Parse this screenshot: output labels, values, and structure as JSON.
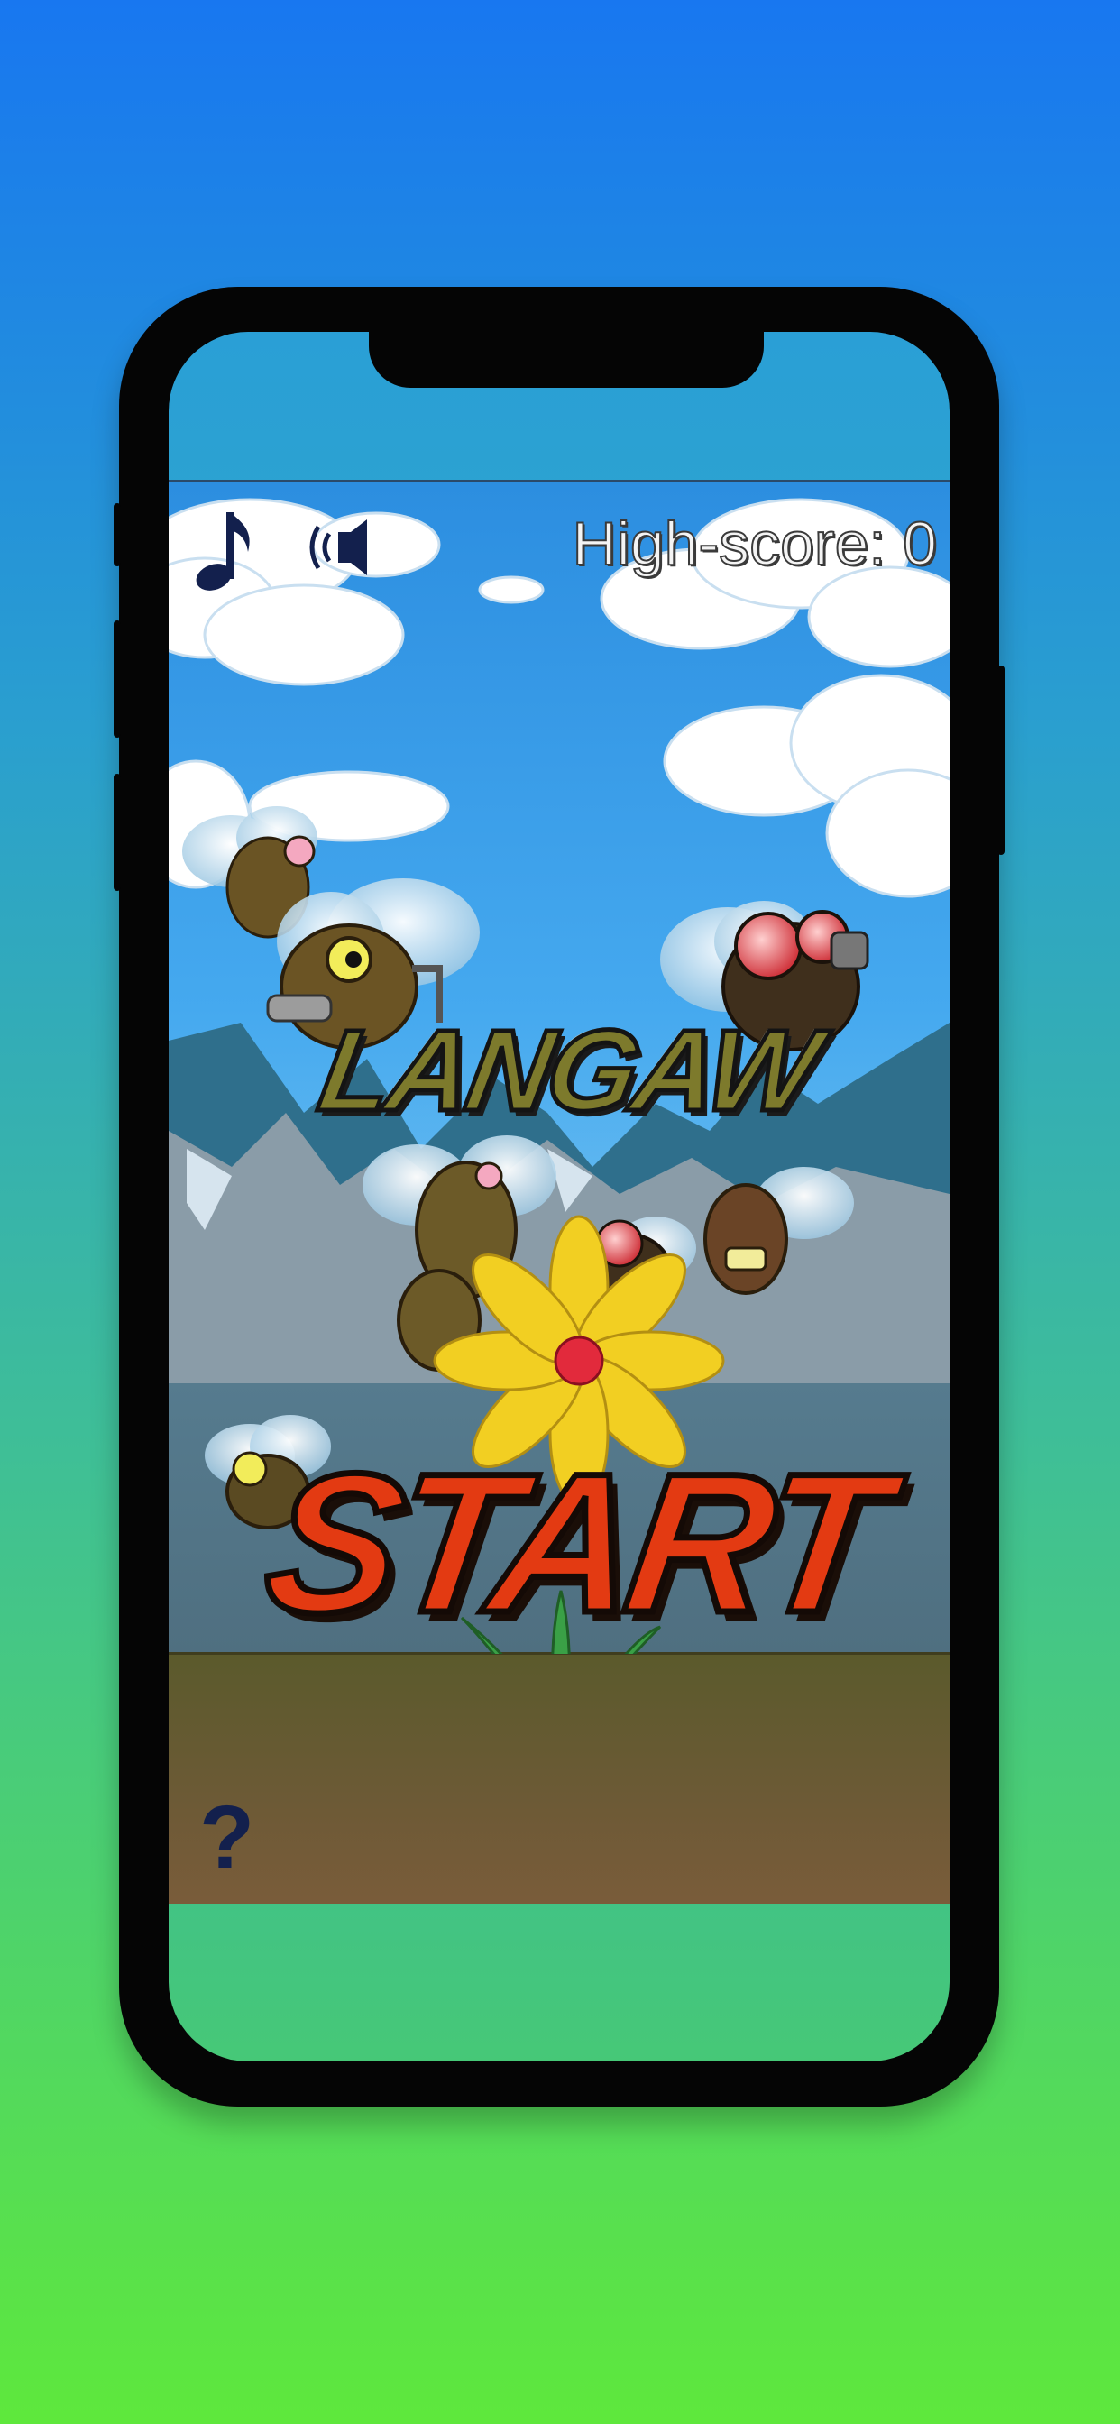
{
  "hud": {
    "high_score_label": "High-score: 0",
    "music_icon": "music-note-icon",
    "sound_icon": "speaker-icon",
    "help_label": "?"
  },
  "game": {
    "logo": "LANGAW",
    "start_label": "START"
  },
  "colors": {
    "background_top": "#1877f0",
    "background_bottom": "#5ee83c",
    "start_red": "#e33a12",
    "logo_olive": "#7d7a2c",
    "icon_navy": "#13204d"
  }
}
